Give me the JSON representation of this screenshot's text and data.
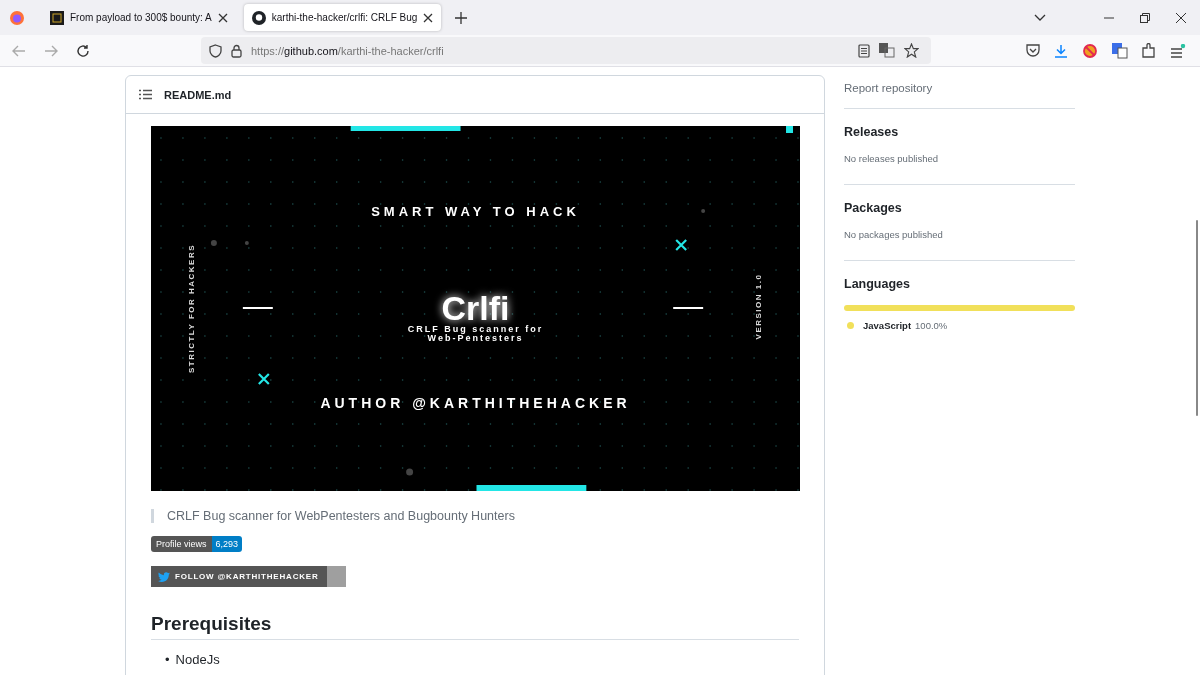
{
  "tabs": [
    {
      "title": "From payload to 300$ bounty: A",
      "selected": false
    },
    {
      "title": "karthi-the-hacker/crlfi: CRLF Bug",
      "selected": true
    }
  ],
  "address": {
    "scheme": "https://",
    "host": "github.com",
    "path": "/karthi-the-hacker/crlfi"
  },
  "readme": {
    "title": "README.md",
    "banner": {
      "tagline": "SMART WAY TO HACK",
      "side_left": "STRICTLY FOR HACKERS",
      "side_right": "VERSION 1.0",
      "name": "Crlfi",
      "subtitle": [
        "CRLF Bug scanner for",
        "Web-Pentesters"
      ],
      "author": "AUTHOR @KARTHITHEHACKER"
    },
    "quote": "CRLF Bug scanner for WebPentesters and Bugbounty Hunters",
    "badge": {
      "label": "Profile views",
      "value": "6,293"
    },
    "follow": "FOLLOW @KARTHITHEHACKER",
    "heading": "Prerequisites",
    "list": [
      {
        "marker": "•",
        "text": "NodeJs"
      }
    ]
  },
  "sidebar": {
    "report": "Report repository",
    "sections": [
      {
        "title": "Releases",
        "text": "No releases published"
      },
      {
        "title": "Packages",
        "text": "No packages published"
      }
    ],
    "languages": {
      "title": "Languages",
      "items": [
        {
          "name": "JavaScript",
          "percent": "100.0%",
          "color": "#f1e05a",
          "level": 1
        }
      ]
    }
  }
}
